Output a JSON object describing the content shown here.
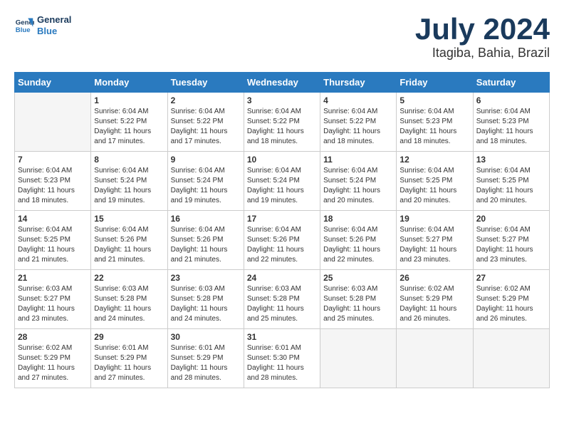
{
  "header": {
    "logo_line1": "General",
    "logo_line2": "Blue",
    "month": "July 2024",
    "location": "Itagiba, Bahia, Brazil"
  },
  "weekdays": [
    "Sunday",
    "Monday",
    "Tuesday",
    "Wednesday",
    "Thursday",
    "Friday",
    "Saturday"
  ],
  "weeks": [
    [
      {
        "day": "",
        "sunrise": "",
        "sunset": "",
        "daylight": ""
      },
      {
        "day": "1",
        "sunrise": "Sunrise: 6:04 AM",
        "sunset": "Sunset: 5:22 PM",
        "daylight": "Daylight: 11 hours and 17 minutes."
      },
      {
        "day": "2",
        "sunrise": "Sunrise: 6:04 AM",
        "sunset": "Sunset: 5:22 PM",
        "daylight": "Daylight: 11 hours and 17 minutes."
      },
      {
        "day": "3",
        "sunrise": "Sunrise: 6:04 AM",
        "sunset": "Sunset: 5:22 PM",
        "daylight": "Daylight: 11 hours and 18 minutes."
      },
      {
        "day": "4",
        "sunrise": "Sunrise: 6:04 AM",
        "sunset": "Sunset: 5:22 PM",
        "daylight": "Daylight: 11 hours and 18 minutes."
      },
      {
        "day": "5",
        "sunrise": "Sunrise: 6:04 AM",
        "sunset": "Sunset: 5:23 PM",
        "daylight": "Daylight: 11 hours and 18 minutes."
      },
      {
        "day": "6",
        "sunrise": "Sunrise: 6:04 AM",
        "sunset": "Sunset: 5:23 PM",
        "daylight": "Daylight: 11 hours and 18 minutes."
      }
    ],
    [
      {
        "day": "7",
        "sunrise": "Sunrise: 6:04 AM",
        "sunset": "Sunset: 5:23 PM",
        "daylight": "Daylight: 11 hours and 18 minutes."
      },
      {
        "day": "8",
        "sunrise": "Sunrise: 6:04 AM",
        "sunset": "Sunset: 5:24 PM",
        "daylight": "Daylight: 11 hours and 19 minutes."
      },
      {
        "day": "9",
        "sunrise": "Sunrise: 6:04 AM",
        "sunset": "Sunset: 5:24 PM",
        "daylight": "Daylight: 11 hours and 19 minutes."
      },
      {
        "day": "10",
        "sunrise": "Sunrise: 6:04 AM",
        "sunset": "Sunset: 5:24 PM",
        "daylight": "Daylight: 11 hours and 19 minutes."
      },
      {
        "day": "11",
        "sunrise": "Sunrise: 6:04 AM",
        "sunset": "Sunset: 5:24 PM",
        "daylight": "Daylight: 11 hours and 20 minutes."
      },
      {
        "day": "12",
        "sunrise": "Sunrise: 6:04 AM",
        "sunset": "Sunset: 5:25 PM",
        "daylight": "Daylight: 11 hours and 20 minutes."
      },
      {
        "day": "13",
        "sunrise": "Sunrise: 6:04 AM",
        "sunset": "Sunset: 5:25 PM",
        "daylight": "Daylight: 11 hours and 20 minutes."
      }
    ],
    [
      {
        "day": "14",
        "sunrise": "Sunrise: 6:04 AM",
        "sunset": "Sunset: 5:25 PM",
        "daylight": "Daylight: 11 hours and 21 minutes."
      },
      {
        "day": "15",
        "sunrise": "Sunrise: 6:04 AM",
        "sunset": "Sunset: 5:26 PM",
        "daylight": "Daylight: 11 hours and 21 minutes."
      },
      {
        "day": "16",
        "sunrise": "Sunrise: 6:04 AM",
        "sunset": "Sunset: 5:26 PM",
        "daylight": "Daylight: 11 hours and 21 minutes."
      },
      {
        "day": "17",
        "sunrise": "Sunrise: 6:04 AM",
        "sunset": "Sunset: 5:26 PM",
        "daylight": "Daylight: 11 hours and 22 minutes."
      },
      {
        "day": "18",
        "sunrise": "Sunrise: 6:04 AM",
        "sunset": "Sunset: 5:26 PM",
        "daylight": "Daylight: 11 hours and 22 minutes."
      },
      {
        "day": "19",
        "sunrise": "Sunrise: 6:04 AM",
        "sunset": "Sunset: 5:27 PM",
        "daylight": "Daylight: 11 hours and 23 minutes."
      },
      {
        "day": "20",
        "sunrise": "Sunrise: 6:04 AM",
        "sunset": "Sunset: 5:27 PM",
        "daylight": "Daylight: 11 hours and 23 minutes."
      }
    ],
    [
      {
        "day": "21",
        "sunrise": "Sunrise: 6:03 AM",
        "sunset": "Sunset: 5:27 PM",
        "daylight": "Daylight: 11 hours and 23 minutes."
      },
      {
        "day": "22",
        "sunrise": "Sunrise: 6:03 AM",
        "sunset": "Sunset: 5:28 PM",
        "daylight": "Daylight: 11 hours and 24 minutes."
      },
      {
        "day": "23",
        "sunrise": "Sunrise: 6:03 AM",
        "sunset": "Sunset: 5:28 PM",
        "daylight": "Daylight: 11 hours and 24 minutes."
      },
      {
        "day": "24",
        "sunrise": "Sunrise: 6:03 AM",
        "sunset": "Sunset: 5:28 PM",
        "daylight": "Daylight: 11 hours and 25 minutes."
      },
      {
        "day": "25",
        "sunrise": "Sunrise: 6:03 AM",
        "sunset": "Sunset: 5:28 PM",
        "daylight": "Daylight: 11 hours and 25 minutes."
      },
      {
        "day": "26",
        "sunrise": "Sunrise: 6:02 AM",
        "sunset": "Sunset: 5:29 PM",
        "daylight": "Daylight: 11 hours and 26 minutes."
      },
      {
        "day": "27",
        "sunrise": "Sunrise: 6:02 AM",
        "sunset": "Sunset: 5:29 PM",
        "daylight": "Daylight: 11 hours and 26 minutes."
      }
    ],
    [
      {
        "day": "28",
        "sunrise": "Sunrise: 6:02 AM",
        "sunset": "Sunset: 5:29 PM",
        "daylight": "Daylight: 11 hours and 27 minutes."
      },
      {
        "day": "29",
        "sunrise": "Sunrise: 6:01 AM",
        "sunset": "Sunset: 5:29 PM",
        "daylight": "Daylight: 11 hours and 27 minutes."
      },
      {
        "day": "30",
        "sunrise": "Sunrise: 6:01 AM",
        "sunset": "Sunset: 5:29 PM",
        "daylight": "Daylight: 11 hours and 28 minutes."
      },
      {
        "day": "31",
        "sunrise": "Sunrise: 6:01 AM",
        "sunset": "Sunset: 5:30 PM",
        "daylight": "Daylight: 11 hours and 28 minutes."
      },
      {
        "day": "",
        "sunrise": "",
        "sunset": "",
        "daylight": ""
      },
      {
        "day": "",
        "sunrise": "",
        "sunset": "",
        "daylight": ""
      },
      {
        "day": "",
        "sunrise": "",
        "sunset": "",
        "daylight": ""
      }
    ]
  ]
}
